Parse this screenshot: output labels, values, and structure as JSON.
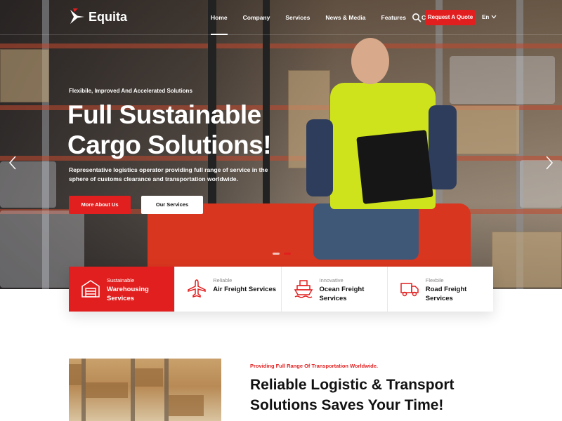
{
  "brand": {
    "name": "Equita",
    "accent": "#e21f1f"
  },
  "nav": {
    "items": [
      {
        "label": "Home",
        "active": true
      },
      {
        "label": "Company",
        "active": false
      },
      {
        "label": "Services",
        "active": false
      },
      {
        "label": "News & Media",
        "active": false
      },
      {
        "label": "Features",
        "active": false
      },
      {
        "label": "Contacts",
        "active": false
      }
    ],
    "quote_label": "Request A Quote",
    "lang_label": "En",
    "icons": {
      "search": "search-icon",
      "lang": "chevron-down-icon"
    }
  },
  "hero": {
    "kicker": "Flexibile, Improved And Accelerated Solutions",
    "headline": "Full Sustainable Cargo Solutions!",
    "description": "Representative logistics operator providing full range of service in the sphere of customs clearance and transportation worldwide.",
    "primary_button": "More About Us",
    "secondary_button": "Our Services",
    "slider": {
      "slides": 2,
      "active_index": 1
    }
  },
  "services": [
    {
      "sub": "Sustainable",
      "title": "Warehousing Services",
      "icon": "warehouse-icon",
      "active": true
    },
    {
      "sub": "Reliable",
      "title": "Air Freight Services",
      "icon": "airplane-icon",
      "active": false
    },
    {
      "sub": "Innovative",
      "title": "Ocean Freight Services",
      "icon": "ship-icon",
      "active": false
    },
    {
      "sub": "Flexbile",
      "title": "Road Freight Services",
      "icon": "truck-icon",
      "active": false
    }
  ],
  "about": {
    "kicker": "Providing Full Range Of Transportation Worldwide.",
    "title": "Reliable Logistic & Transport Solutions Saves Your Time!"
  }
}
